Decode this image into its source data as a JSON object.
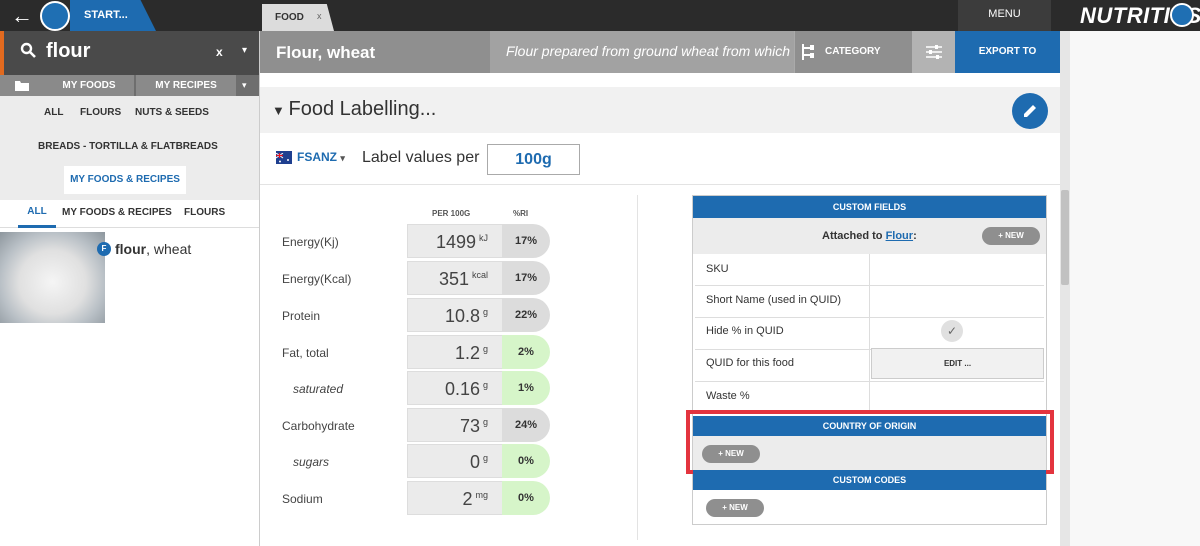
{
  "topbar": {
    "start_label": "START...",
    "tab_label": "FOOD",
    "tab_close": "x",
    "menu_label": "MENU",
    "brand": "NUTRITICS",
    "back_icon": "arrow-left-icon"
  },
  "sidebar": {
    "search_value": "flour",
    "search_clear": "x",
    "search_dropdown": "▾",
    "subtabs": {
      "my_foods": "MY FOODS",
      "my_recipes": "MY RECIPES",
      "dropdown": "▾"
    },
    "filters": [
      "ALL",
      "FLOURS",
      "NUTS & SEEDS"
    ],
    "filter_breads": "BREADS - TORTILLA & FLATBREADS",
    "filter_myfoods_recipes": "MY FOODS & RECIPES",
    "tabs": [
      "ALL",
      "MY FOODS & RECIPES",
      "FLOURS"
    ],
    "result": {
      "badge": "F",
      "name_bold": "flour",
      "name_rest": ", wheat"
    }
  },
  "header": {
    "title": "Flour, wheat",
    "description": "Flour prepared from ground wheat from which",
    "category_label": "CATEGORY",
    "export_label": "EXPORT TO"
  },
  "labelling": {
    "title": "Food Labelling...",
    "standard": "FSANZ",
    "standard_dd": "▾",
    "label_values_per": "Label values per",
    "per_value": "100g",
    "col_per100": "PER 100G",
    "col_ri": "%RI",
    "rows": [
      {
        "label": "Energy(Kj)",
        "value": "1499",
        "unit": "kJ",
        "ri": "17%",
        "green": false,
        "indent": false
      },
      {
        "label": "Energy(Kcal)",
        "value": "351",
        "unit": "kcal",
        "ri": "17%",
        "green": false,
        "indent": false
      },
      {
        "label": "Protein",
        "value": "10.8",
        "unit": "g",
        "ri": "22%",
        "green": false,
        "indent": false
      },
      {
        "label": "Fat, total",
        "value": "1.2",
        "unit": "g",
        "ri": "2%",
        "green": true,
        "indent": false
      },
      {
        "label": "saturated",
        "value": "0.16",
        "unit": "g",
        "ri": "1%",
        "green": true,
        "indent": true
      },
      {
        "label": "Carbohydrate",
        "value": "73",
        "unit": "g",
        "ri": "24%",
        "green": false,
        "indent": false
      },
      {
        "label": "sugars",
        "value": "0",
        "unit": "g",
        "ri": "0%",
        "green": true,
        "indent": true
      },
      {
        "label": "Sodium",
        "value": "2",
        "unit": "mg",
        "ri": "0%",
        "green": true,
        "indent": false
      }
    ]
  },
  "custom_fields": {
    "title": "CUSTOM FIELDS",
    "attached_to": "Attached to",
    "attached_link": "Flour",
    "attached_colon": ":",
    "new_label": "+ NEW",
    "rows": [
      "SKU",
      "Short Name (used in QUID)",
      "Hide % in QUID",
      "QUID for this food",
      "Waste %"
    ],
    "hide_check": "✓",
    "edit_label": "EDIT ..."
  },
  "country_of_origin": {
    "title": "COUNTRY OF ORIGIN",
    "new_label": "+ NEW"
  },
  "custom_codes": {
    "title": "CUSTOM CODES",
    "new_label": "+ NEW"
  },
  "colors": {
    "accent": "#1e6bb0",
    "highlight": "#e3343e",
    "search_accent": "#e26a1f"
  }
}
